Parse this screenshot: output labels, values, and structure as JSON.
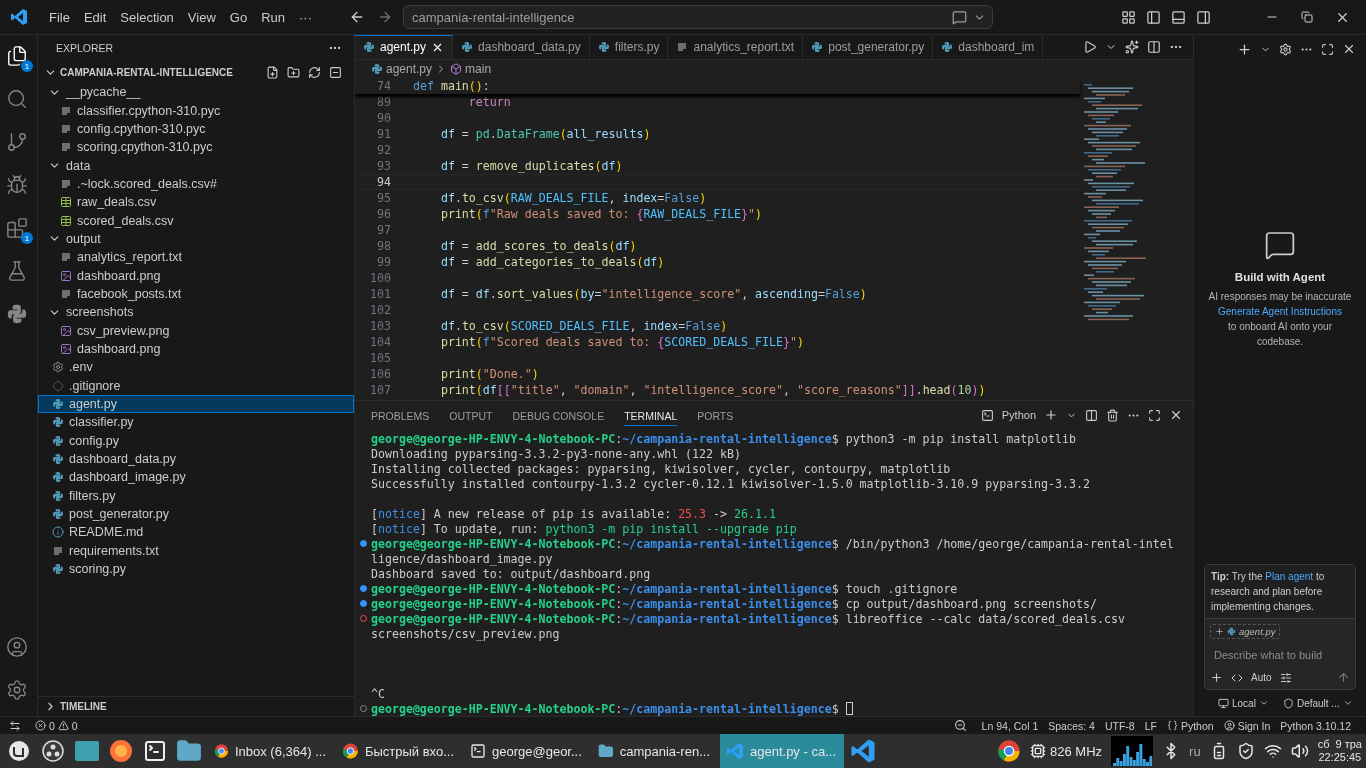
{
  "titlebar": {
    "menu": [
      "File",
      "Edit",
      "Selection",
      "View",
      "Go",
      "Run",
      "···"
    ],
    "search": "campania-rental-intelligence"
  },
  "activity_bar": [
    {
      "kind": "explorer",
      "badge": "1",
      "selected": true
    },
    {
      "kind": "search",
      "selected": false
    },
    {
      "kind": "source-control",
      "selected": false
    },
    {
      "kind": "run-debug",
      "selected": false
    },
    {
      "kind": "extensions",
      "badge": "1",
      "selected": false
    },
    {
      "kind": "testing",
      "selected": false
    },
    {
      "kind": "python",
      "selected": false
    }
  ],
  "activity_bar_bottom": [
    {
      "kind": "account"
    },
    {
      "kind": "settings"
    }
  ],
  "explorer": {
    "title": "EXPLORER",
    "root": {
      "label": "CAMPANIA-RENTAL-INTELLIGENCE",
      "expanded": true
    },
    "items": [
      {
        "label": "__pycache__",
        "kind": "folder",
        "expanded": true,
        "selected": false,
        "children": [
          {
            "label": "classifier.cpython-310.pyc",
            "kind": "text",
            "selected": false
          },
          {
            "label": "config.cpython-310.pyc",
            "kind": "text",
            "selected": false
          },
          {
            "label": "scoring.cpython-310.pyc",
            "kind": "text",
            "selected": false
          }
        ]
      },
      {
        "label": "data",
        "kind": "folder",
        "expanded": true,
        "selected": false,
        "children": [
          {
            "label": ".~lock.scored_deals.csv#",
            "kind": "text",
            "selected": false
          },
          {
            "label": "raw_deals.csv",
            "kind": "csv",
            "selected": false
          },
          {
            "label": "scored_deals.csv",
            "kind": "csv",
            "selected": false
          }
        ]
      },
      {
        "label": "output",
        "kind": "folder",
        "expanded": true,
        "selected": false,
        "children": [
          {
            "label": "analytics_report.txt",
            "kind": "text",
            "selected": false
          },
          {
            "label": "dashboard.png",
            "kind": "image",
            "selected": false
          },
          {
            "label": "facebook_posts.txt",
            "kind": "text",
            "selected": false
          }
        ]
      },
      {
        "label": "screenshots",
        "kind": "folder",
        "expanded": true,
        "selected": false,
        "children": [
          {
            "label": "csv_preview.png",
            "kind": "image",
            "selected": false
          },
          {
            "label": "dashboard.png",
            "kind": "image",
            "selected": false
          }
        ]
      },
      {
        "label": ".env",
        "kind": "env",
        "selected": false
      },
      {
        "label": ".gitignore",
        "kind": "git",
        "selected": false
      },
      {
        "label": "agent.py",
        "kind": "python",
        "selected": true
      },
      {
        "label": "classifier.py",
        "kind": "python",
        "selected": false
      },
      {
        "label": "config.py",
        "kind": "python",
        "selected": false
      },
      {
        "label": "dashboard_data.py",
        "kind": "python",
        "selected": false
      },
      {
        "label": "dashboard_image.py",
        "kind": "python",
        "selected": false
      },
      {
        "label": "filters.py",
        "kind": "python",
        "selected": false
      },
      {
        "label": "post_generator.py",
        "kind": "python",
        "selected": false
      },
      {
        "label": "README.md",
        "kind": "info",
        "selected": false
      },
      {
        "label": "requirements.txt",
        "kind": "text",
        "selected": false
      },
      {
        "label": "scoring.py",
        "kind": "python",
        "selected": false
      }
    ],
    "timeline": {
      "label": "TIMELINE",
      "expanded": false
    }
  },
  "editor": {
    "tabs": [
      {
        "label": "agent.py",
        "kind": "python",
        "selected": true
      },
      {
        "label": "dashboard_data.py",
        "kind": "python",
        "selected": false
      },
      {
        "label": "filters.py",
        "kind": "python",
        "selected": false
      },
      {
        "label": "analytics_report.txt",
        "kind": "text",
        "selected": false
      },
      {
        "label": "post_generator.py",
        "kind": "python",
        "selected": false
      },
      {
        "label": "dashboard_im",
        "kind": "python",
        "selected": false
      }
    ],
    "breadcrumb": {
      "file": "agent.py",
      "symbol": "main"
    },
    "sticky": {
      "number": "74",
      "tokens": [
        {
          "kind": "kw",
          "text": "def"
        },
        {
          "kind": "fn",
          "text": " main"
        },
        {
          "kind": "paren",
          "text": "()"
        },
        {
          "kind": "plain",
          "text": ":"
        }
      ]
    },
    "lines": [
      {
        "number": "89",
        "current": false,
        "tokens": [
          {
            "kind": "ctl",
            "text": "        return"
          }
        ]
      },
      {
        "number": "90",
        "current": false
      },
      {
        "number": "91",
        "current": false,
        "tokens": [
          {
            "kind": "var",
            "text": "    df"
          },
          {
            "kind": "plain",
            "text": " = "
          },
          {
            "kind": "cls",
            "text": "pd"
          },
          {
            "kind": "plain",
            "text": "."
          },
          {
            "kind": "cls",
            "text": "DataFrame"
          },
          {
            "kind": "paren",
            "text": "("
          },
          {
            "kind": "var",
            "text": "all_results"
          },
          {
            "kind": "paren",
            "text": ")"
          }
        ]
      },
      {
        "number": "92",
        "current": false
      },
      {
        "number": "93",
        "current": false,
        "tokens": [
          {
            "kind": "var",
            "text": "    df"
          },
          {
            "kind": "plain",
            "text": " = "
          },
          {
            "kind": "fn",
            "text": "remove_duplicates"
          },
          {
            "kind": "paren",
            "text": "("
          },
          {
            "kind": "var",
            "text": "df"
          },
          {
            "kind": "paren",
            "text": ")"
          }
        ]
      },
      {
        "number": "94",
        "current": true
      },
      {
        "number": "95",
        "current": false,
        "tokens": [
          {
            "kind": "var",
            "text": "    df"
          },
          {
            "kind": "plain",
            "text": "."
          },
          {
            "kind": "fn",
            "text": "to_csv"
          },
          {
            "kind": "paren",
            "text": "("
          },
          {
            "kind": "const",
            "text": "RAW_DEALS_FILE"
          },
          {
            "kind": "plain",
            "text": ", "
          },
          {
            "kind": "var",
            "text": "index"
          },
          {
            "kind": "plain",
            "text": "="
          },
          {
            "kind": "bool",
            "text": "False"
          },
          {
            "kind": "paren",
            "text": ")"
          }
        ]
      },
      {
        "number": "96",
        "current": false,
        "tokens": [
          {
            "kind": "fn",
            "text": "    print"
          },
          {
            "kind": "paren",
            "text": "("
          },
          {
            "kind": "bool",
            "text": "f"
          },
          {
            "kind": "str",
            "text": "\"Raw deals saved to: "
          },
          {
            "kind": "brace",
            "text": "{"
          },
          {
            "kind": "const",
            "text": "RAW_DEALS_FILE"
          },
          {
            "kind": "brace",
            "text": "}"
          },
          {
            "kind": "str",
            "text": "\""
          },
          {
            "kind": "paren",
            "text": ")"
          }
        ]
      },
      {
        "number": "97",
        "current": false
      },
      {
        "number": "98",
        "current": false,
        "tokens": [
          {
            "kind": "var",
            "text": "    df"
          },
          {
            "kind": "plain",
            "text": " = "
          },
          {
            "kind": "fn",
            "text": "add_scores_to_deals"
          },
          {
            "kind": "paren",
            "text": "("
          },
          {
            "kind": "var",
            "text": "df"
          },
          {
            "kind": "paren",
            "text": ")"
          }
        ]
      },
      {
        "number": "99",
        "current": false,
        "tokens": [
          {
            "kind": "var",
            "text": "    df"
          },
          {
            "kind": "plain",
            "text": " = "
          },
          {
            "kind": "fn",
            "text": "add_categories_to_deals"
          },
          {
            "kind": "paren",
            "text": "("
          },
          {
            "kind": "var",
            "text": "df"
          },
          {
            "kind": "paren",
            "text": ")"
          }
        ]
      },
      {
        "number": "100",
        "current": false
      },
      {
        "number": "101",
        "current": false,
        "tokens": [
          {
            "kind": "var",
            "text": "    df"
          },
          {
            "kind": "plain",
            "text": " = "
          },
          {
            "kind": "var",
            "text": "df"
          },
          {
            "kind": "plain",
            "text": "."
          },
          {
            "kind": "fn",
            "text": "sort_values"
          },
          {
            "kind": "paren",
            "text": "("
          },
          {
            "kind": "var",
            "text": "by"
          },
          {
            "kind": "plain",
            "text": "="
          },
          {
            "kind": "str",
            "text": "\"intelligence_score\""
          },
          {
            "kind": "plain",
            "text": ", "
          },
          {
            "kind": "var",
            "text": "ascending"
          },
          {
            "kind": "plain",
            "text": "="
          },
          {
            "kind": "bool",
            "text": "False"
          },
          {
            "kind": "paren",
            "text": ")"
          }
        ]
      },
      {
        "number": "102",
        "current": false
      },
      {
        "number": "103",
        "current": false,
        "tokens": [
          {
            "kind": "var",
            "text": "    df"
          },
          {
            "kind": "plain",
            "text": "."
          },
          {
            "kind": "fn",
            "text": "to_csv"
          },
          {
            "kind": "paren",
            "text": "("
          },
          {
            "kind": "const",
            "text": "SCORED_DEALS_FILE"
          },
          {
            "kind": "plain",
            "text": ", "
          },
          {
            "kind": "var",
            "text": "index"
          },
          {
            "kind": "plain",
            "text": "="
          },
          {
            "kind": "bool",
            "text": "False"
          },
          {
            "kind": "paren",
            "text": ")"
          }
        ]
      },
      {
        "number": "104",
        "current": false,
        "tokens": [
          {
            "kind": "fn",
            "text": "    print"
          },
          {
            "kind": "paren",
            "text": "("
          },
          {
            "kind": "bool",
            "text": "f"
          },
          {
            "kind": "str",
            "text": "\"Scored deals saved to: "
          },
          {
            "kind": "brace",
            "text": "{"
          },
          {
            "kind": "const",
            "text": "SCORED_DEALS_FILE"
          },
          {
            "kind": "brace",
            "text": "}"
          },
          {
            "kind": "str",
            "text": "\""
          },
          {
            "kind": "paren",
            "text": ")"
          }
        ]
      },
      {
        "number": "105",
        "current": false
      },
      {
        "number": "106",
        "current": false,
        "tokens": [
          {
            "kind": "fn",
            "text": "    print"
          },
          {
            "kind": "paren",
            "text": "("
          },
          {
            "kind": "str",
            "text": "\"Done.\""
          },
          {
            "kind": "paren",
            "text": ")"
          }
        ]
      },
      {
        "number": "107",
        "current": false,
        "tokens": [
          {
            "kind": "fn",
            "text": "    print"
          },
          {
            "kind": "paren",
            "text": "("
          },
          {
            "kind": "var",
            "text": "df"
          },
          {
            "kind": "brace",
            "text": "[["
          },
          {
            "kind": "str",
            "text": "\"title\""
          },
          {
            "kind": "plain",
            "text": ", "
          },
          {
            "kind": "str",
            "text": "\"domain\""
          },
          {
            "kind": "plain",
            "text": ", "
          },
          {
            "kind": "str",
            "text": "\"intelligence_score\""
          },
          {
            "kind": "plain",
            "text": ", "
          },
          {
            "kind": "str",
            "text": "\"score_reasons\""
          },
          {
            "kind": "brace",
            "text": "]]"
          },
          {
            "kind": "plain",
            "text": "."
          },
          {
            "kind": "fn",
            "text": "head"
          },
          {
            "kind": "brace",
            "text": "("
          },
          {
            "kind": "num",
            "text": "10"
          },
          {
            "kind": "brace",
            "text": ")"
          },
          {
            "kind": "paren",
            "text": ")"
          }
        ]
      }
    ]
  },
  "panel": {
    "tabs": [
      {
        "label": "PROBLEMS",
        "selected": false
      },
      {
        "label": "OUTPUT",
        "selected": false
      },
      {
        "label": "DEBUG CONSOLE",
        "selected": false
      },
      {
        "label": "TERMINAL",
        "selected": true
      },
      {
        "label": "PORTS",
        "selected": false
      }
    ],
    "terminal_name": "Python",
    "lines": [
      {
        "tokens": [
          {
            "kind": "user",
            "text": "george@george-HP-ENVY-4-Notebook-PC"
          },
          {
            "kind": "plain",
            "text": ":"
          },
          {
            "kind": "path",
            "text": "~/campania-rental-intelligence"
          },
          {
            "kind": "plain",
            "text": "$ python3 -m pip install matplotlib"
          }
        ]
      },
      {
        "tokens": [
          {
            "kind": "plain",
            "text": "Downloading pyparsing-3.3.2-py3-none-any.whl (122 kB)"
          }
        ]
      },
      {
        "tokens": [
          {
            "kind": "plain",
            "text": "Installing collected packages: pyparsing, kiwisolver, cycler, contourpy, matplotlib"
          }
        ]
      },
      {
        "tokens": [
          {
            "kind": "plain",
            "text": "Successfully installed contourpy-1.3.2 cycler-0.12.1 kiwisolver-1.5.0 matplotlib-3.10.9 pyparsing-3.3.2"
          }
        ]
      },
      {
        "kind": "blank"
      },
      {
        "tokens": [
          {
            "kind": "plain",
            "text": "["
          },
          {
            "kind": "notice",
            "text": "notice"
          },
          {
            "kind": "plain",
            "text": "] A new release of pip is available: "
          },
          {
            "kind": "red",
            "text": "25.3"
          },
          {
            "kind": "plain",
            "text": " -> "
          },
          {
            "kind": "green",
            "text": "26.1.1"
          }
        ]
      },
      {
        "tokens": [
          {
            "kind": "plain",
            "text": "["
          },
          {
            "kind": "notice",
            "text": "notice"
          },
          {
            "kind": "plain",
            "text": "] To update, run: "
          },
          {
            "kind": "green",
            "text": "python3 -m pip install --upgrade pip"
          }
        ]
      },
      {
        "kind": "success",
        "tokens": [
          {
            "kind": "user",
            "text": "george@george-HP-ENVY-4-Notebook-PC"
          },
          {
            "kind": "plain",
            "text": ":"
          },
          {
            "kind": "path",
            "text": "~/campania-rental-intelligence"
          },
          {
            "kind": "plain",
            "text": "$ /bin/python3 /home/george/campania-rental-intel"
          }
        ]
      },
      {
        "tokens": [
          {
            "kind": "plain",
            "text": "ligence/dashboard_image.py"
          }
        ]
      },
      {
        "tokens": [
          {
            "kind": "plain",
            "text": "Dashboard saved to: output/dashboard.png"
          }
        ]
      },
      {
        "kind": "success",
        "tokens": [
          {
            "kind": "user",
            "text": "george@george-HP-ENVY-4-Notebook-PC"
          },
          {
            "kind": "plain",
            "text": ":"
          },
          {
            "kind": "path",
            "text": "~/campania-rental-intelligence"
          },
          {
            "kind": "plain",
            "text": "$ touch .gitignore"
          }
        ]
      },
      {
        "kind": "success",
        "tokens": [
          {
            "kind": "user",
            "text": "george@george-HP-ENVY-4-Notebook-PC"
          },
          {
            "kind": "plain",
            "text": ":"
          },
          {
            "kind": "path",
            "text": "~/campania-rental-intelligence"
          },
          {
            "kind": "plain",
            "text": "$ cp output/dashboard.png screenshots/"
          }
        ]
      },
      {
        "kind": "error",
        "tokens": [
          {
            "kind": "user",
            "text": "george@george-HP-ENVY-4-Notebook-PC"
          },
          {
            "kind": "plain",
            "text": ":"
          },
          {
            "kind": "path",
            "text": "~/campania-rental-intelligence"
          },
          {
            "kind": "plain",
            "text": "$ libreoffice --calc data/scored_deals.csv"
          }
        ]
      },
      {
        "tokens": [
          {
            "kind": "plain",
            "text": "screenshots/csv_preview.png"
          }
        ]
      },
      {
        "kind": "blank"
      },
      {
        "kind": "blank"
      },
      {
        "kind": "blank"
      },
      {
        "tokens": [
          {
            "kind": "plain",
            "text": "^C"
          }
        ]
      },
      {
        "kind": "idle",
        "cursor": true,
        "tokens": [
          {
            "kind": "user",
            "text": "george@george-HP-ENVY-4-Notebook-PC"
          },
          {
            "kind": "plain",
            "text": ":"
          },
          {
            "kind": "path",
            "text": "~/campania-rental-intelligence"
          },
          {
            "kind": "plain",
            "text": "$"
          }
        ]
      }
    ]
  },
  "chat": {
    "title": "Build with Agent",
    "disclaimer": "AI responses may be inaccurate",
    "link": "Generate Agent Instructions",
    "after_link": "to onboard AI onto your codebase.",
    "tip": {
      "before": "**Tip:** Try the",
      "link": "Plan agent",
      "after": "to research and plan before implementing changes."
    },
    "attachment": "agent.py",
    "placeholder": "Describe what to build",
    "mode": "Auto",
    "location": "Local",
    "approval": "Default ..."
  },
  "status_bar": {
    "errors": "0",
    "warnings": "0",
    "items": [
      "Ln 94, Col 1",
      "Spaces: 4",
      "UTF-8",
      "LF"
    ],
    "language": "Python",
    "sign_in": "Sign In",
    "interpreter": "Python 3.10.12"
  },
  "taskbar": {
    "launchers": [
      {
        "kind": "menu"
      },
      {
        "kind": "obs"
      },
      {
        "kind": "files-tile"
      },
      {
        "kind": "firefox"
      },
      {
        "kind": "terminal"
      },
      {
        "kind": "folder"
      }
    ],
    "windows": [
      {
        "label": "Inbox (6,364) ...",
        "kind": "chrome",
        "selected": false
      },
      {
        "label": "Быстрый вхо...",
        "kind": "chrome",
        "selected": false
      },
      {
        "label": "george@geor...",
        "kind": "terminal",
        "selected": false
      },
      {
        "label": "campania-ren...",
        "kind": "folder",
        "selected": false
      },
      {
        "label": "agent.py - ca...",
        "kind": "vscode",
        "selected": true
      }
    ],
    "cpu": "826 MHz",
    "layout": "ru",
    "date": "сб  9 тра",
    "time": "22:25:45"
  }
}
